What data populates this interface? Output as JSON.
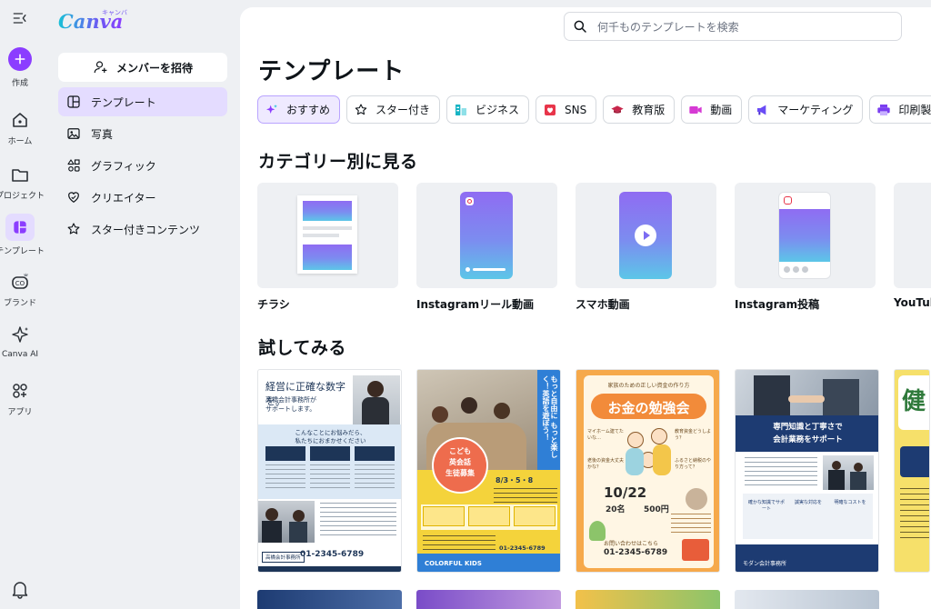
{
  "rail": {
    "create": "作成",
    "home": "ホーム",
    "projects": "プロジェクト",
    "templates": "テンプレート",
    "brand": "ブランド",
    "canva_ai": "Canva AI",
    "apps": "アプリ"
  },
  "logo": {
    "text": "Canva",
    "kana": "キャンバ"
  },
  "panel": {
    "invite": "メンバーを招待",
    "items": [
      {
        "label": "テンプレート",
        "icon": "template-icon",
        "active": true
      },
      {
        "label": "写真",
        "icon": "photo-icon"
      },
      {
        "label": "グラフィック",
        "icon": "shapes-icon"
      },
      {
        "label": "クリエイター",
        "icon": "heart-icon"
      },
      {
        "label": "スター付きコンテンツ",
        "icon": "star-icon"
      }
    ]
  },
  "search": {
    "placeholder": "何千ものテンプレートを検索"
  },
  "page_title": "テンプレート",
  "chips": [
    {
      "label": "おすすめ",
      "icon": "sparkle-icon",
      "color": "#8b3dff",
      "active": true
    },
    {
      "label": "スター付き",
      "icon": "star-icon",
      "color": "#0e1318"
    },
    {
      "label": "ビジネス",
      "icon": "chart-icon",
      "color": "#17b4c4"
    },
    {
      "label": "SNS",
      "icon": "heart-icon",
      "color": "#e8354a"
    },
    {
      "label": "教育版",
      "icon": "graduation-icon",
      "color": "#c7264b"
    },
    {
      "label": "動画",
      "icon": "video-icon",
      "color": "#d63ad4"
    },
    {
      "label": "マーケティング",
      "icon": "megaphone-icon",
      "color": "#6a4cf5"
    },
    {
      "label": "印刷製品",
      "icon": "printer-icon",
      "color": "#7a3ef0"
    }
  ],
  "section_categories": "カテゴリー別に見る",
  "categories": [
    {
      "label": "チラシ"
    },
    {
      "label": "Instagramリール動画"
    },
    {
      "label": "スマホ動画"
    },
    {
      "label": "Instagram投稿"
    },
    {
      "label": "YouTube"
    }
  ],
  "section_try": "試してみる",
  "templates": [
    {
      "headline": "経営に正確な数字を。",
      "sub1": "高橋会計事務所が",
      "sub2": "サポートします。",
      "ribbon": "こんなことにお悩みだら、",
      "ribbon2": "私たちにおまかせください",
      "phone": "01-2345-6789",
      "office": "高橋会計事務所"
    },
    {
      "side": "もっと自由に もっと楽しく！英語を遊ぼう！",
      "badge1": "こども",
      "badge2": "英会話",
      "badge3": "生徒募集",
      "date": "8/3・5・8",
      "phone": "01-2345-6789",
      "footer": "COLORFUL KIDS"
    },
    {
      "top": "家族のための正しい資金の作り方",
      "title": "お金の勉強会",
      "q1": "マイホーム建てたいな…",
      "q2": "教育資金どうしよう？",
      "q3": "老後の資金大丈夫かな？",
      "q4": "ふるさと納税のやり方って？",
      "date": "10/22",
      "capacity": "20名",
      "fee": "500円",
      "contact": "お問い合わせはこちら",
      "phone": "01-2345-6789"
    },
    {
      "title1": "専門知識と丁寧さで",
      "title2": "会計業務をサポート",
      "b1": "確かな知識でサポート",
      "b2": "誠実な対応を",
      "b3": "明確なコストを",
      "office": "モダン会計事務所"
    },
    {
      "title": "健"
    }
  ]
}
